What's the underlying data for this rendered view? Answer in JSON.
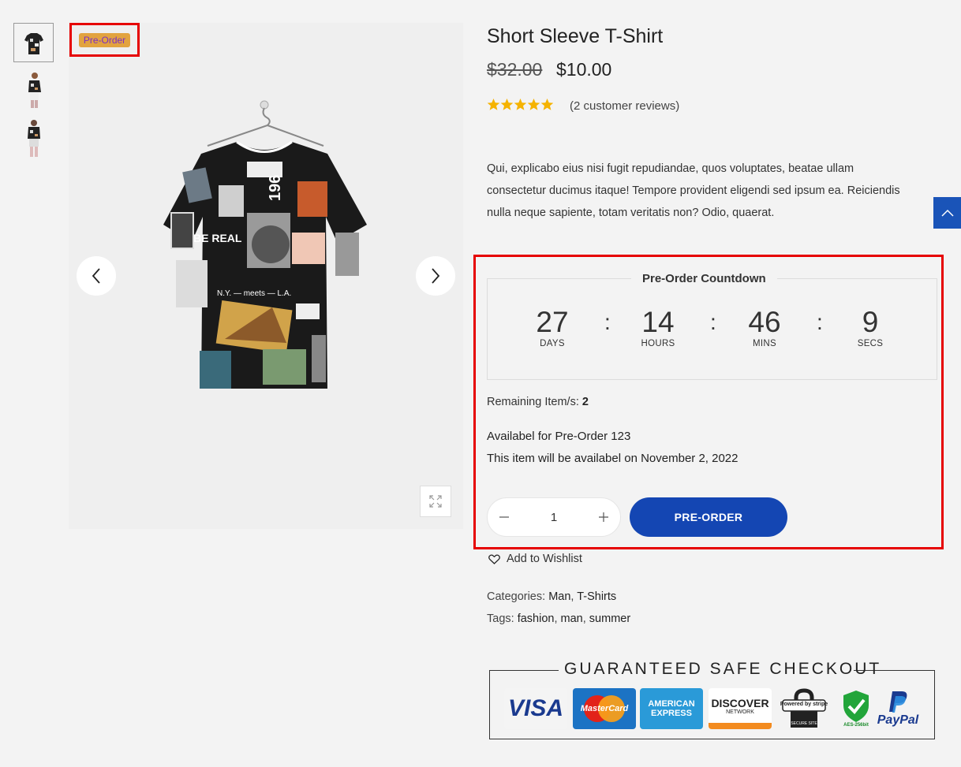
{
  "product": {
    "title": "Short Sleeve T-Shirt",
    "price_old": "$32.00",
    "price_new": "$10.00",
    "rating_stars": 5,
    "reviews": "(2 customer reviews)",
    "description": "Qui, explicabo eius nisi fugit repudiandae, quos voluptates, beatae ullam consectetur ducimus itaque! Tempore provident eligendi sed ipsum ea. Reiciendis nulla neque sapiente, totam veritatis non? Odio, quaerat.",
    "badge": "Pre-Order"
  },
  "gallery": {
    "thumbnails": [
      "shirt-front",
      "model-side",
      "model-full"
    ],
    "prev_icon": "chevron-left-icon",
    "next_icon": "chevron-right-icon",
    "zoom_icon": "expand-icon"
  },
  "countdown": {
    "title": "Pre-Order Countdown",
    "units": [
      {
        "value": "27",
        "label": "DAYS"
      },
      {
        "value": "14",
        "label": "HOURS"
      },
      {
        "value": "46",
        "label": "MINS"
      },
      {
        "value": "9",
        "label": "SECS"
      }
    ],
    "separator": ":"
  },
  "stock": {
    "label": "Remaining Item/s: ",
    "count": "2"
  },
  "availability": {
    "line1": "Availabel for Pre-Order 123",
    "line2": "This item will be availabel on November 2, 2022"
  },
  "cart": {
    "quantity": "1",
    "button": "PRE-ORDER"
  },
  "wishlist": "Add to Wishlist",
  "meta": {
    "categories_label": "Categories: ",
    "categories": [
      "Man",
      "T-Shirts"
    ],
    "tags_label": "Tags: ",
    "tags": [
      "fashion",
      "man",
      "summer"
    ]
  },
  "checkout": {
    "title": "GUARANTEED SAFE CHECKOUT",
    "methods": [
      "VISA",
      "MasterCard",
      "AMERICAN EXPRESS",
      "DISCOVER",
      "Powered by stripe",
      "AES-256bit",
      "PayPal"
    ],
    "labels": {
      "mastercard": "MasterCard",
      "amex1": "AMERICAN",
      "amex2": "EXPRESS",
      "discover1": "DISCOVER",
      "discover2": "NETWORK",
      "stripe1": "Powered by stripe",
      "stripe2": "SECURE SITE",
      "aes": "AES-256bit",
      "paypal": "PayPal"
    }
  },
  "colors": {
    "accent": "#1446b3",
    "highlight": "#e60000",
    "badge_bg": "#e2a33f",
    "badge_text": "#7b2fc4",
    "star": "#f5b301"
  }
}
